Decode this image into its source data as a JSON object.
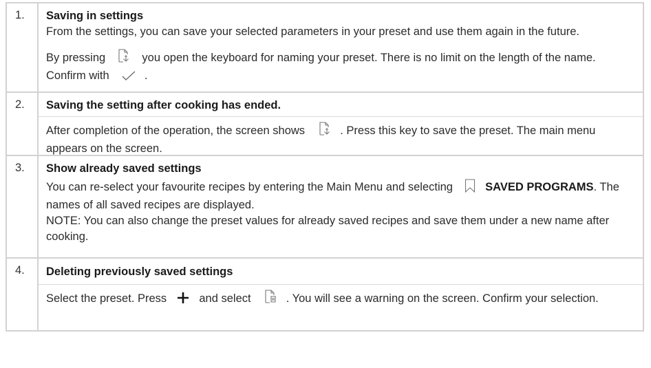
{
  "steps": [
    {
      "number": "1.",
      "title": "Saving in settings",
      "p1": "From the settings, you can save your selected parameters in your preset and use them again in the future.",
      "p2_a": "By pressing",
      "p2_b": "you open the keyboard for naming your preset. There is no limit on the length of the name. Confirm with",
      "p2_c": "."
    },
    {
      "number": "2.",
      "title": "Saving the setting after cooking has ended.",
      "p1_a": "After completion of the operation, the screen shows",
      "p1_b": ". Press this key to save the preset. The main menu appears on the screen."
    },
    {
      "number": "3.",
      "title": "Show already saved settings",
      "p1_a": "You can re-select your favourite recipes by entering the Main Menu and selecting",
      "p1_bold": "SAVED PROGRAMS",
      "p1_b": ". The names of all saved recipes are displayed.",
      "note": "NOTE: You can also change the preset values for already saved recipes and save them under a new name after cooking."
    },
    {
      "number": "4.",
      "title": "Deleting previously saved settings",
      "p1_a": "Select the preset. Press",
      "p1_b": "and select",
      "p1_c": ". You will see a warning on the screen. Confirm your selection."
    }
  ],
  "icons": {
    "save": "save-preset-icon",
    "confirm": "checkmark-icon",
    "bookmark": "bookmark-icon",
    "add": "plus-icon",
    "delete": "delete-preset-icon"
  }
}
